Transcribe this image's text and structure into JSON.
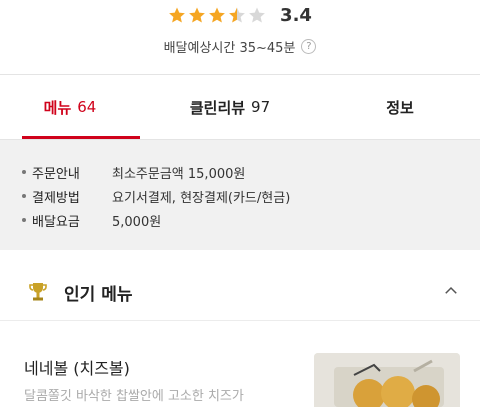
{
  "header": {
    "rating_value": "3.4",
    "stars_filled": 3.5,
    "stars_total": 5,
    "delivery_time_text": "배달예상시간 35~45분",
    "help_icon_glyph": "?"
  },
  "tabs": [
    {
      "label": "메뉴",
      "count": "64",
      "active": true
    },
    {
      "label": "클린리뷰",
      "count": "97",
      "active": false
    },
    {
      "label": "정보",
      "count": "",
      "active": false
    }
  ],
  "info": [
    {
      "label": "주문안내",
      "value": "최소주문금액 15,000원"
    },
    {
      "label": "결제방법",
      "value": "요기서결제, 현장결제(카드/현금)"
    },
    {
      "label": "배달요금",
      "value": "5,000원"
    }
  ],
  "popular": {
    "title": "인기 메뉴",
    "icon": "trophy-icon",
    "toggle_icon": "chevron-up-icon"
  },
  "menu_items": [
    {
      "name": "네네볼 (치즈볼)",
      "description": "달콤쫄깃 바삭한 찹쌀안에 고소한 치즈가"
    }
  ],
  "colors": {
    "accent": "#d0021b",
    "star": "#f5a623",
    "star_empty": "#d8d8d8",
    "info_bg": "#f1f1f1"
  }
}
